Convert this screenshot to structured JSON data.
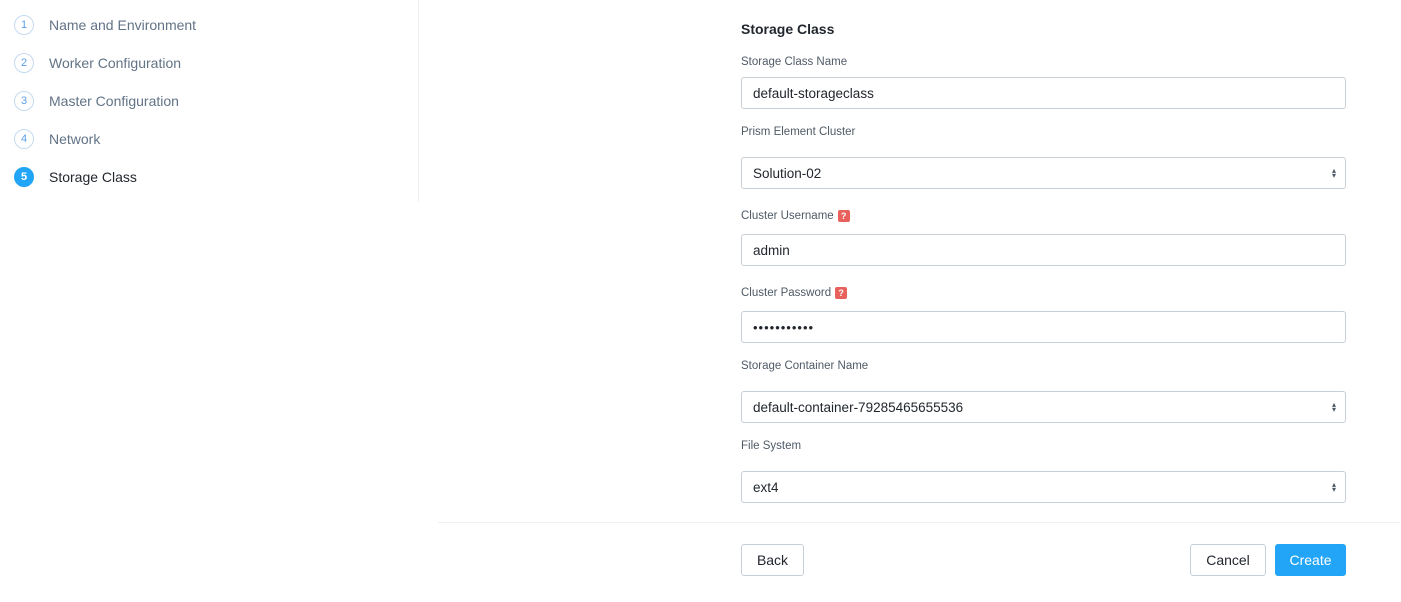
{
  "steps": [
    {
      "number": "1",
      "label": "Name and Environment"
    },
    {
      "number": "2",
      "label": "Worker Configuration"
    },
    {
      "number": "3",
      "label": "Master Configuration"
    },
    {
      "number": "4",
      "label": "Network"
    },
    {
      "number": "5",
      "label": "Storage Class"
    }
  ],
  "form": {
    "section_title": "Storage Class",
    "storage_class_name": {
      "label": "Storage Class Name",
      "value": "default-storageclass"
    },
    "prism_element_cluster": {
      "label": "Prism Element Cluster",
      "value": "Solution-02"
    },
    "cluster_username": {
      "label": "Cluster Username",
      "value": "admin"
    },
    "cluster_password": {
      "label": "Cluster Password",
      "value": "•••••••••••"
    },
    "storage_container_name": {
      "label": "Storage Container Name",
      "value": "default-container-79285465655536"
    },
    "file_system": {
      "label": "File System",
      "value": "ext4"
    },
    "help_glyph": "?"
  },
  "footer": {
    "back_label": "Back",
    "cancel_label": "Cancel",
    "create_label": "Create"
  },
  "colors": {
    "primary": "#22a5f7",
    "help_badge": "#e8615c",
    "muted_text": "#627386"
  }
}
